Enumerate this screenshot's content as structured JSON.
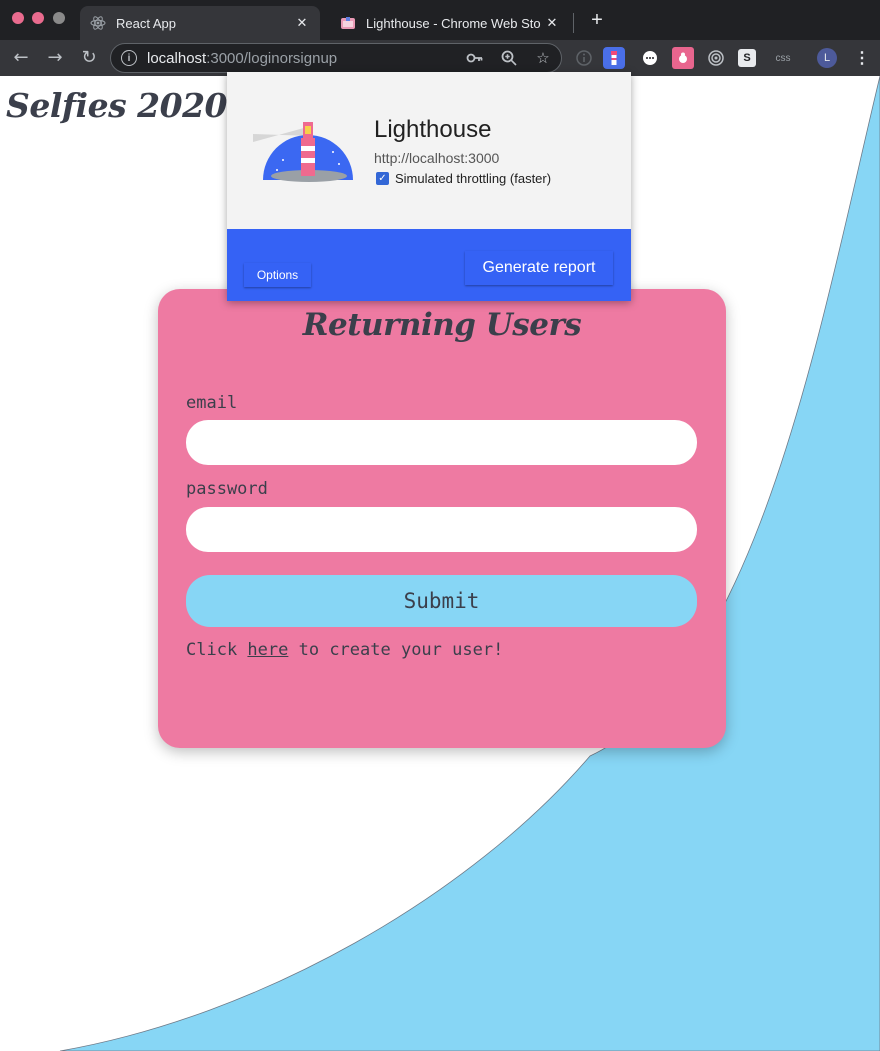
{
  "browser": {
    "tabs": [
      {
        "title": "React App",
        "favicon": "react-icon",
        "active": true
      },
      {
        "title": "Lighthouse - Chrome Web Sto",
        "favicon": "lighthouse-icon",
        "active": false
      }
    ],
    "new_tab_symbol": "+",
    "url": {
      "host": "localhost",
      "rest": ":3000/loginorsignup"
    },
    "omnibox_icons": [
      "key-icon",
      "zoom-icon",
      "star-icon"
    ],
    "extensions": [
      "info-icon",
      "lighthouse-extension-icon",
      "chat-icon",
      "bug-icon",
      "target-icon",
      "s-icon",
      "css-icon"
    ],
    "extension_labels": {
      "s": "S",
      "css": "css"
    },
    "profile_initial": "L",
    "colors": {
      "close": "#e96b8e",
      "minimize": "#e96b8e",
      "zoom": "#8a8a8a",
      "profile": "#4d5a9a"
    }
  },
  "page": {
    "brand": "Selfies 2020",
    "login_card": {
      "title": "Returning Users",
      "email_label": "email",
      "email_value": "",
      "password_label": "password",
      "password_value": "",
      "submit_label": "Submit",
      "create_prefix": "Click ",
      "create_link": "here",
      "create_suffix": " to create your user!"
    },
    "colors": {
      "card": "#ee7aa2",
      "accent_blue": "#87d6f5",
      "text": "#3b3f4b"
    }
  },
  "lighthouse_popup": {
    "title": "Lighthouse",
    "url": "http://localhost:3000",
    "throttling_label": "Simulated throttling (faster)",
    "throttling_checked": true,
    "options_label": "Options",
    "generate_label": "Generate report",
    "colors": {
      "footer": "#3562f5"
    }
  }
}
